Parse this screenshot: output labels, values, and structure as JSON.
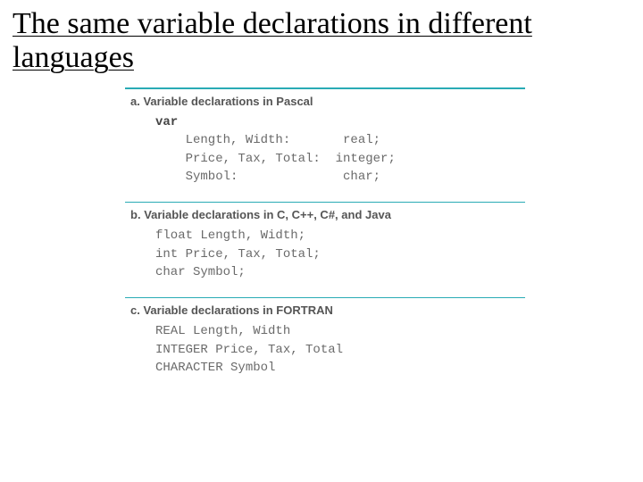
{
  "title": "The same variable declarations in different languages",
  "sections": {
    "a": {
      "label": "a.",
      "heading": "Variable declarations in Pascal",
      "keyword": "var",
      "line1": "    Length, Width:       real;",
      "line2": "    Price, Tax, Total:  integer;",
      "line3": "    Symbol:              char;"
    },
    "b": {
      "label": "b.",
      "heading": "Variable declarations in C, C++, C#, and Java",
      "line1": "float Length, Width;",
      "line2": "int Price, Tax, Total;",
      "line3": "char Symbol;"
    },
    "c": {
      "label": "c.",
      "heading": "Variable declarations in FORTRAN",
      "line1": "REAL Length, Width",
      "line2": "INTEGER Price, Tax, Total",
      "line3": "CHARACTER Symbol"
    }
  }
}
